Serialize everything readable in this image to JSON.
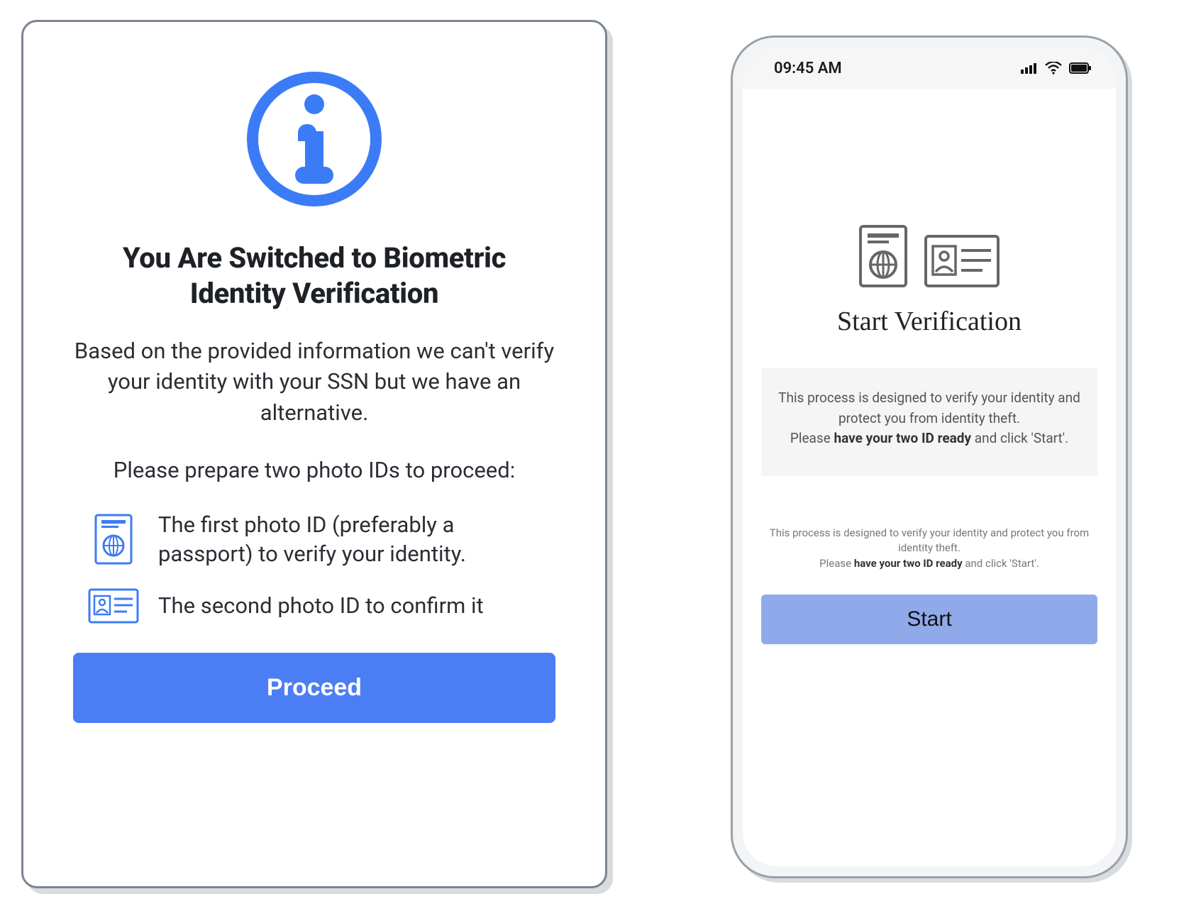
{
  "left": {
    "title": "You Are Switched to Biometric Identity Verification",
    "paragraph1": "Based on the provided information we can't verify your identity with your SSN but we have an alternative.",
    "paragraph2": "Please prepare two photo IDs to proceed:",
    "item1": "The first photo ID (preferably a passport) to verify your identity.",
    "item2": "The second photo ID to confirm it",
    "proceed": "Proceed"
  },
  "phone": {
    "time": "09:45 AM",
    "title": "Start Verification",
    "box_line1": "This process is designed to verify your identity and protect you from identity theft.",
    "box_line2a": "Please ",
    "box_line2b": "have your two ID ready",
    "box_line2c": " and click 'Start'.",
    "note_line1": "This process is designed to verify your identity and protect you from identity theft.",
    "note_line2a": "Please ",
    "note_line2b": "have your two ID ready",
    "note_line2c": " and click 'Start'.",
    "start": "Start"
  },
  "colors": {
    "primary": "#3b7cf6",
    "button": "#4b7df5",
    "phone_button": "#90a9eb"
  }
}
